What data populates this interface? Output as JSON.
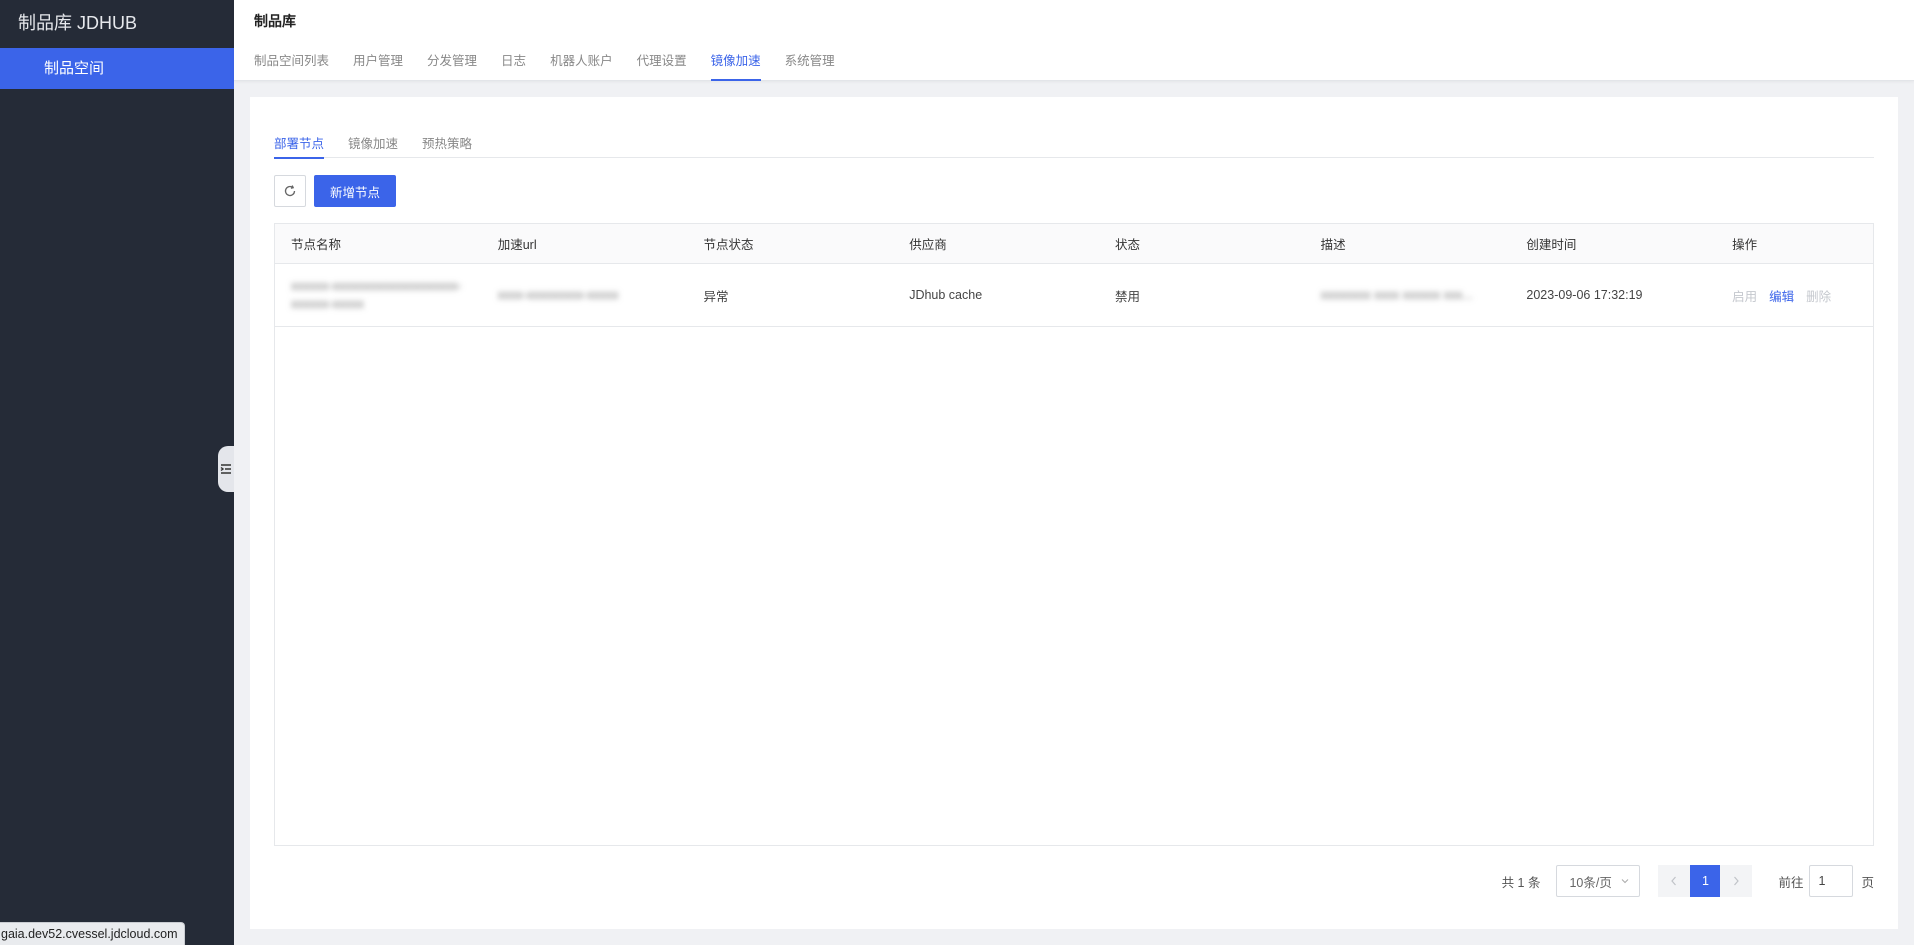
{
  "sidebar": {
    "brand": "制品库 JDHUB",
    "items": [
      {
        "label": "制品空间",
        "active": true
      }
    ]
  },
  "status_bar_url": "gaia.dev52.cvessel.jdcloud.com",
  "header": {
    "title": "制品库",
    "tabs": [
      {
        "label": "制品空间列表",
        "active": false
      },
      {
        "label": "用户管理",
        "active": false
      },
      {
        "label": "分发管理",
        "active": false
      },
      {
        "label": "日志",
        "active": false
      },
      {
        "label": "机器人账户",
        "active": false
      },
      {
        "label": "代理设置",
        "active": false
      },
      {
        "label": "镜像加速",
        "active": true
      },
      {
        "label": "系统管理",
        "active": false
      }
    ]
  },
  "sub_tabs": [
    {
      "label": "部署节点",
      "active": true
    },
    {
      "label": "镜像加速",
      "active": false
    },
    {
      "label": "预热策略",
      "active": false
    }
  ],
  "toolbar": {
    "refresh_icon": "refresh-icon",
    "add_button": "新增节点"
  },
  "table": {
    "columns": [
      "节点名称",
      "加速url",
      "节点状态",
      "供应商",
      "状态",
      "描述",
      "创建时间",
      "操作"
    ],
    "rows": [
      {
        "name": "xxxxxx-xxxxxxxxxxxxxxxxxxxx-xxxxxx-xxxxx",
        "url": "xxxx-xxxxxxxxx-xxxxx",
        "node_status": "异常",
        "provider": "JDhub cache",
        "status": "禁用",
        "description": "xxxxxxxx xxxx xxxxxx xxx...",
        "created": "2023-09-06 17:32:19",
        "actions": {
          "enable": "启用",
          "edit": "编辑",
          "delete": "删除"
        }
      }
    ]
  },
  "pagination": {
    "total": "共 1 条",
    "page_size": "10条/页",
    "current_page": "1",
    "goto_label": "前往",
    "goto_value": "1",
    "goto_unit": "页"
  },
  "colors": {
    "accent": "#3b64e9",
    "sidebar_bg": "#252b37"
  }
}
